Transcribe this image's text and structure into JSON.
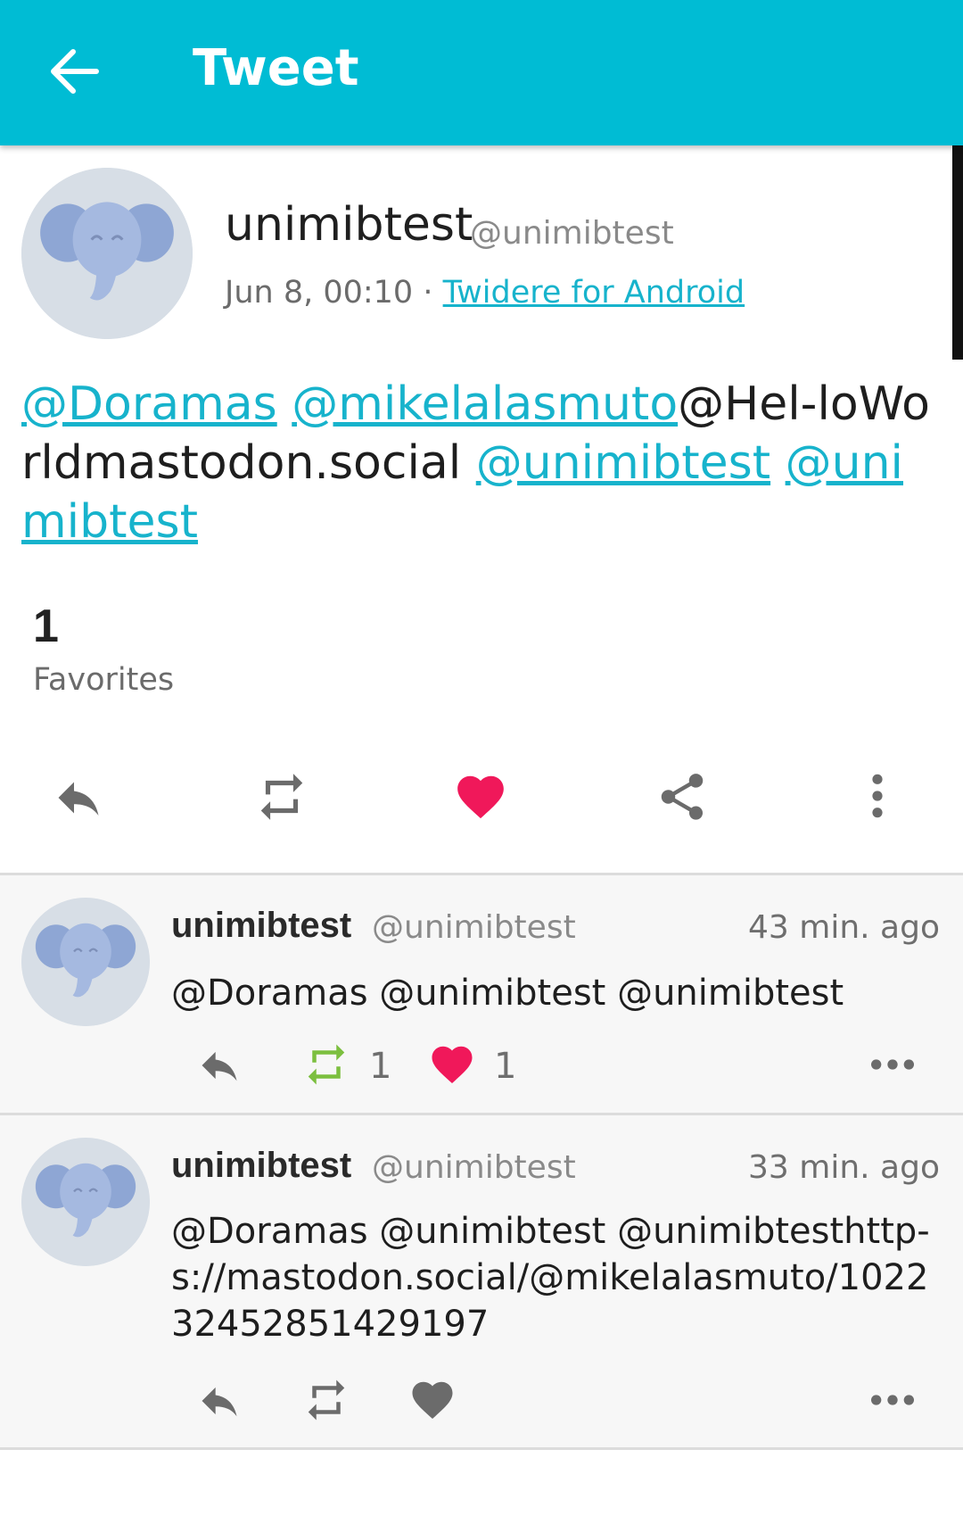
{
  "appbar": {
    "title": "Tweet",
    "back_icon": "arrow-left-icon"
  },
  "status": {
    "name": "unimibtest",
    "handle": "@unimibtest",
    "date": "Jun 8, 00:10",
    "separator": " · ",
    "source": "Twidere for Android",
    "text_parts": [
      {
        "text": "@Doramas",
        "type": "mention"
      },
      {
        "text": " ",
        "type": "plain"
      },
      {
        "text": "@mikelalasmuto",
        "type": "mention"
      },
      {
        "text": "@Hel-loWorldmastodon.social ",
        "type": "plain"
      },
      {
        "text": "@unimibtest",
        "type": "mention"
      },
      {
        "text": " ",
        "type": "plain"
      },
      {
        "text": "@unimibtest",
        "type": "mention"
      }
    ],
    "favorites_count": "1",
    "favorites_label": "Favorites",
    "actions": [
      "reply-icon",
      "retweet-icon",
      "heart-icon",
      "share-icon",
      "more-vert-icon"
    ],
    "favorited": true
  },
  "replies": [
    {
      "name": "unimibtest",
      "handle": "@unimibtest",
      "time": "43 min. ago",
      "text": "@Doramas @unimibtest @unimibtest",
      "retweet_count": "1",
      "favorite_count": "1",
      "retweeted": true,
      "favorited": true
    },
    {
      "name": "unimibtest",
      "handle": "@unimibtest",
      "time": "33 min. ago",
      "text": "@Doramas @unimibtest @unimibtesthttp-s://mastodon.social/@mikelalasmuto/102232452851429197",
      "retweeted": false,
      "favorited": false
    }
  ],
  "colors": {
    "accent": "#00bcd4",
    "link": "#17b3cc",
    "favorite": "#f0185a",
    "retweet": "#7cbf3f",
    "icon_gray": "#6b6b6b"
  }
}
